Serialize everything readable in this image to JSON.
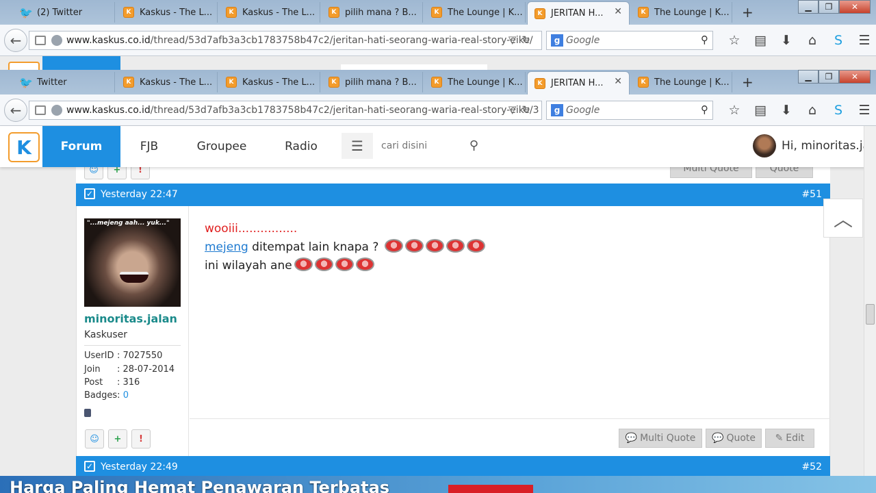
{
  "browser_back": {
    "tabs": [
      {
        "label": "(2) Twitter",
        "icon": "twitter"
      },
      {
        "label": "Kaskus - The L...",
        "icon": "kaskus"
      },
      {
        "label": "Kaskus - The L...",
        "icon": "kaskus"
      },
      {
        "label": "pilih mana ? B...",
        "icon": "kaskus"
      },
      {
        "label": "The Lounge | K...",
        "icon": "kaskus"
      },
      {
        "label": "JERITAN H...",
        "icon": "kaskus",
        "active": true
      },
      {
        "label": "The Lounge | K...",
        "icon": "kaskus"
      }
    ],
    "url_domain": "www.kaskus.co.id",
    "url_path": "/thread/53d7afb3a3cb1783758b47c2/jeritan-hati-seorang-waria-real-story-eike/",
    "search_placeholder": "Google"
  },
  "browser_front": {
    "tabs": [
      {
        "label": "Twitter",
        "icon": "twitter"
      },
      {
        "label": "Kaskus - The L...",
        "icon": "kaskus"
      },
      {
        "label": "Kaskus - The L...",
        "icon": "kaskus"
      },
      {
        "label": "pilih mana ? B...",
        "icon": "kaskus"
      },
      {
        "label": "The Lounge | K...",
        "icon": "kaskus"
      },
      {
        "label": "JERITAN H...",
        "icon": "kaskus",
        "active": true
      },
      {
        "label": "The Lounge | K...",
        "icon": "kaskus"
      }
    ],
    "url_domain": "www.kaskus.co.id",
    "url_path": "/thread/53d7afb3a3cb1783758b47c2/jeritan-hati-seorang-waria-real-story-eike/3",
    "search_placeholder": "Google"
  },
  "header": {
    "nav": [
      "Forum",
      "FJB",
      "Groupee",
      "Radio"
    ],
    "active_nav": "Forum",
    "search_placeholder": "cari disini",
    "greeting": "Hi, minoritas.ja"
  },
  "post51": {
    "time": "Yesterday 22:47",
    "number": "#51",
    "avatar_caption": "\"...mejeng aah... yuk...\"",
    "username": "minoritas.jalan",
    "rank": "Kaskuser",
    "userid_label": "UserID",
    "userid": ": 7027550",
    "join_label": "Join",
    "join": ": 28-07-2014",
    "post_label": "Post",
    "post": ": 316",
    "badges_label": "Badges:",
    "badges": "0",
    "line1": "wooiii................",
    "line2_link": "mejeng",
    "line2_text": " ditempat lain knapa ? ",
    "line3_text": "ini wilayah ane",
    "multi_quote": "Multi Quote",
    "quote": "Quote",
    "edit": "Edit"
  },
  "prev_post": {
    "multi_quote": "Multi Quote",
    "quote": "Quote"
  },
  "post52": {
    "time": "Yesterday 22:49",
    "number": "#52"
  },
  "banner": {
    "text": "Harga Paling Hemat Penawaran Terbatas"
  },
  "colors": {
    "kaskus_blue": "#1e8fe1",
    "kaskus_orange": "#f39c2c",
    "username": "#1a8a8a"
  }
}
